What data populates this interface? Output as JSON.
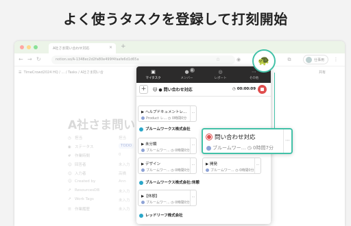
{
  "headline": "よく使うタスクを登録して打刻開始",
  "browser": {
    "tab_title": "A社さま問い合わせ対応",
    "new_tab": "+",
    "url": "notion.so/A-1348ec2d2fa80e499f4faafe6d1d65a",
    "profile_label": "仕事用"
  },
  "notion": {
    "breadcrumb": [
      "TimeCrowd2024 HQ",
      "...",
      "Tasks",
      "A社さま問い合"
    ],
    "share_label": "共有",
    "page_title": "A社さま問い",
    "props": [
      {
        "name": "担当",
        "value": "担当"
      },
      {
        "name": "ステータス",
        "value": "TODO"
      },
      {
        "name": "作業時間",
        "value": "0"
      },
      {
        "name": "回答者",
        "value": "未入力"
      },
      {
        "name": "入力者",
        "value": "高橋"
      },
      {
        "name": "Created by",
        "value": "Ann"
      },
      {
        "name": "ResourcesDB",
        "value": "未入力"
      },
      {
        "name": "Work Tags",
        "value": "未入力"
      },
      {
        "name": "作業履歴",
        "value": "未入力"
      }
    ]
  },
  "popup": {
    "tabs": [
      {
        "label": "マイタスク",
        "icon": "clipboard-icon"
      },
      {
        "label": "メンバー",
        "icon": "person-icon",
        "badge": "8"
      },
      {
        "label": "レポート",
        "icon": "globe-icon"
      },
      {
        "label": "その他",
        "icon": "more-icon"
      }
    ],
    "current_task": "問い合わせ対応",
    "timer": "00:00:09",
    "sections": [
      {
        "name": "ブルームワークス株式会社",
        "cards": [
          {
            "name": "▶ 未分類",
            "sub": "ブルームワー...",
            "time": "0時間0分"
          },
          {
            "name": "▶ デザイン",
            "sub": "ブルームワー...",
            "time": "0時間0分"
          }
        ]
      },
      {
        "name": "ブルームワークス株式会社:休憩",
        "cards": [
          {
            "name": "▶【休憩】",
            "sub": "ブルームワー...",
            "time": "0時間0分"
          }
        ]
      },
      {
        "name": "レッドリーフ株式会社",
        "cards": []
      }
    ],
    "top_card": {
      "name": "▶ ヘルプドキュメントレ...",
      "sub": "Product レ...",
      "time": "0時間0分"
    },
    "right_card": {
      "name": "▶ 開発",
      "sub": "ブルームワー...",
      "time": "0時間0分"
    },
    "highlight_card": {
      "name": "問い合わせ対応",
      "sub": "ブルームワー...",
      "time": "0時間7分"
    }
  }
}
